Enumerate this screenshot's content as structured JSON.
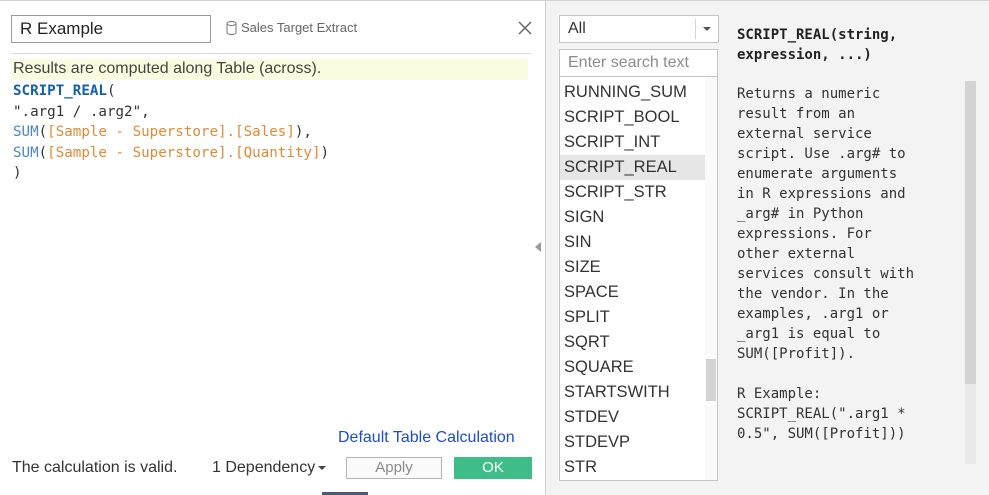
{
  "editor": {
    "calc_name": "R Example",
    "data_source": "Sales Target Extract",
    "results_note": "Results are computed along Table (across).",
    "code": {
      "line1_fn": "SCRIPT_REAL",
      "line1_paren": "(",
      "line2": "\".arg1 / .arg2\",",
      "line3_agg": "SUM",
      "line3_open": "(",
      "line3_field": "[Sample - Superstore].[Sales]",
      "line3_close": "),",
      "line4_agg": "SUM",
      "line4_open": "(",
      "line4_field": "[Sample - Superstore].[Quantity]",
      "line4_close": ")",
      "line5": ")"
    },
    "default_table_calc": "Default Table Calculation",
    "status": "The calculation is valid.",
    "dependency": "1 Dependency",
    "apply_label": "Apply",
    "ok_label": "OK"
  },
  "functions": {
    "category": "All",
    "search_placeholder": "Enter search text",
    "items": [
      "RUNNING_SUM",
      "SCRIPT_BOOL",
      "SCRIPT_INT",
      "SCRIPT_REAL",
      "SCRIPT_STR",
      "SIGN",
      "SIN",
      "SIZE",
      "SPACE",
      "SPLIT",
      "SQRT",
      "SQUARE",
      "STARTSWITH",
      "STDEV",
      "STDEVP",
      "STR"
    ],
    "selected": "SCRIPT_REAL"
  },
  "help": {
    "signature": "SCRIPT_REAL(string,\nexpression, ...)",
    "description": "Returns a numeric\nresult from an\nexternal service\nscript. Use .arg# to\nenumerate arguments\nin R expressions and\n_arg# in Python\nexpressions. For\nother external\nservices consult with\nthe vendor. In the\nexamples, .arg1 or\n_arg1 is equal to\nSUM([Profit]).\n\nR Example:\nSCRIPT_REAL(\".arg1 *\n0.5\", SUM([Profit]))"
  },
  "colors": {
    "ok_button": "#3fbd88",
    "function_keyword": "#1560a8",
    "aggregate": "#4a86c8",
    "field": "#e08a35",
    "link": "#1f4ec2",
    "note_bg": "#fbfbe0"
  },
  "icons": {
    "data_source": "database-icon",
    "close": "close-icon",
    "dropdown": "chevron-down-icon",
    "collapse": "collapse-left-icon"
  }
}
